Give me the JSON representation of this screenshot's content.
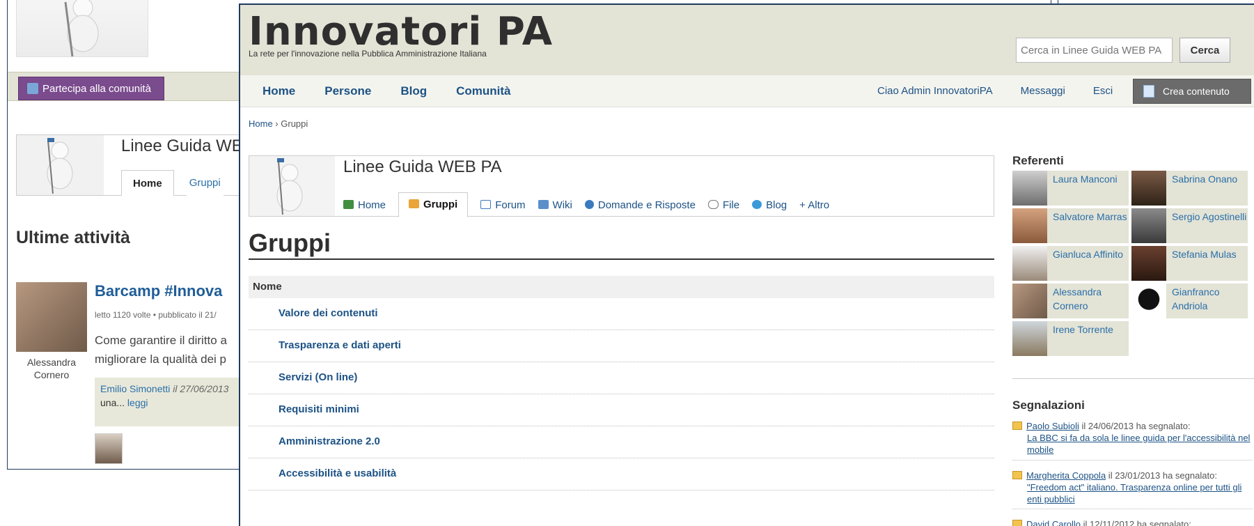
{
  "background_window": {
    "participate_label": "Partecipa alla comunità",
    "group_title": "Linee Guida WEB",
    "tabs": [
      "Home",
      "Gruppi"
    ],
    "section_title": "Ultime attività",
    "activity": {
      "title": "Barcamp #Innova",
      "meta": "letto 1120 volte • pubblicato il 21/",
      "text": "Come garantire il diritto a migliorare la qualità dei p",
      "author": "Alessandra Cornero",
      "comment_author": "Emilio Simonetti",
      "comment_date": "il 27/06/2013",
      "comment_text": "una...",
      "comment_link": "leggi"
    }
  },
  "header": {
    "site_title": "Innovatori PA",
    "subtitle": "La rete per l'innovazione nella Pubblica Amministrazione Italiana",
    "search_placeholder": "Cerca in Linee Guida WEB PA",
    "search_button": "Cerca"
  },
  "nav": {
    "left": [
      "Home",
      "Persone",
      "Blog",
      "Comunità"
    ],
    "greeting": "Ciao Admin InnovatoriPA",
    "messages": "Messaggi",
    "logout": "Esci",
    "create": "Crea contenuto"
  },
  "breadcrumb": {
    "home": "Home",
    "sep": " › ",
    "current": "Gruppi"
  },
  "group": {
    "title": "Linee Guida WEB PA",
    "tabs": [
      {
        "label": "Home",
        "icon": "home-icon"
      },
      {
        "label": "Gruppi",
        "icon": "groups-icon",
        "active": true
      },
      {
        "label": "Forum",
        "icon": "forum-icon"
      },
      {
        "label": "Wiki",
        "icon": "wiki-icon"
      },
      {
        "label": "Domande e Risposte",
        "icon": "question-icon"
      },
      {
        "label": "File",
        "icon": "paperclip-icon"
      },
      {
        "label": "Blog",
        "icon": "blog-icon"
      },
      {
        "label": "+ Altro",
        "icon": ""
      }
    ]
  },
  "page_title": "Gruppi",
  "table": {
    "header": "Nome",
    "rows": [
      "Valore dei contenuti",
      "Trasparenza e dati aperti",
      "Servizi (On line)",
      "Requisiti minimi",
      "Amministrazione 2.0",
      "Accessibilità e usabilità"
    ]
  },
  "referenti": {
    "title": "Referenti",
    "people": [
      "Laura Manconi",
      "Sabrina Onano",
      "Salvatore Marras",
      "Sergio Agostinelli",
      "Gianluca Affinito",
      "Stefania Mulas",
      "Alessandra Cornero",
      "Gianfranco Andriola",
      "Irene Torrente"
    ]
  },
  "segnalazioni": {
    "title": "Segnalazioni",
    "items": [
      {
        "user": "Paolo Subioli",
        "meta": " il 24/06/2013 ha segnalato:",
        "link": "La BBC si fa da sola le linee guida per l'accessibilità nel mobile"
      },
      {
        "user": "Margherita Coppola",
        "meta": " il 23/01/2013 ha segnalato:",
        "link": "\"Freedom act\" italiano. Trasparenza online per tutti gli enti pubblici"
      },
      {
        "user": "David Carollo",
        "meta": " il 12/11/2012 ha segnalato:",
        "link": ""
      }
    ]
  },
  "colors": {
    "accent": "#1c5285",
    "header_bg": "#e3e3d6",
    "purple": "#7a4b8d"
  }
}
